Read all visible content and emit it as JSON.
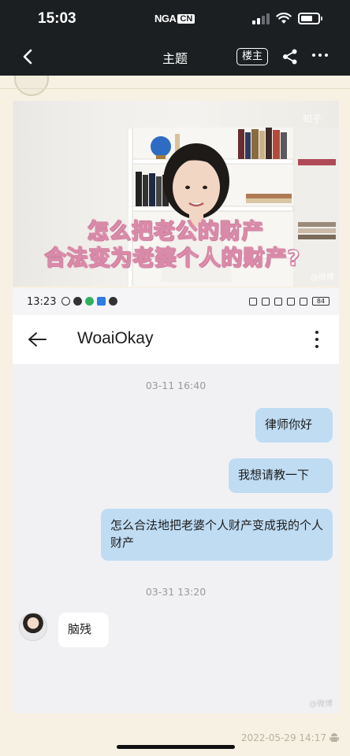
{
  "status_bar": {
    "time": "15:03",
    "carrier_logo_text": "NGA",
    "carrier_logo_badge": "CN"
  },
  "nav": {
    "title": "主题",
    "owner_button": "楼主",
    "back_icon": "chevron-left-icon",
    "share_icon": "share-icon",
    "more_icon": "more-horizontal-icon"
  },
  "post_image": {
    "watermark_top": "知乎",
    "subtitle_line1": "怎么把老公的财产",
    "subtitle_line2": "合法变为老婆个人的财产?",
    "watermark_bottom": "@微博"
  },
  "chat_screenshot": {
    "status_time": "13:23",
    "battery": "84",
    "contact_name": "WoaiOkay",
    "messages": [
      {
        "timestamp": "03-11 16:40"
      },
      {
        "side": "right",
        "text": "律师你好"
      },
      {
        "side": "right",
        "text": "我想请教一下"
      },
      {
        "side": "right",
        "text": "怎么合法地把老婆个人财产变成我的个人财产"
      },
      {
        "timestamp": "03-31 13:20"
      },
      {
        "side": "left",
        "text": "脑残"
      }
    ],
    "watermark": "@微博"
  },
  "post_footer": {
    "timestamp": "2022-05-29 14:17",
    "device_icon": "android-icon"
  },
  "colors": {
    "bar_dark": "#1c1f22",
    "page_bg": "#f7f1e3",
    "bubble_blue": "#bfdcf3",
    "subtitle_outline": "#d98aa8"
  }
}
